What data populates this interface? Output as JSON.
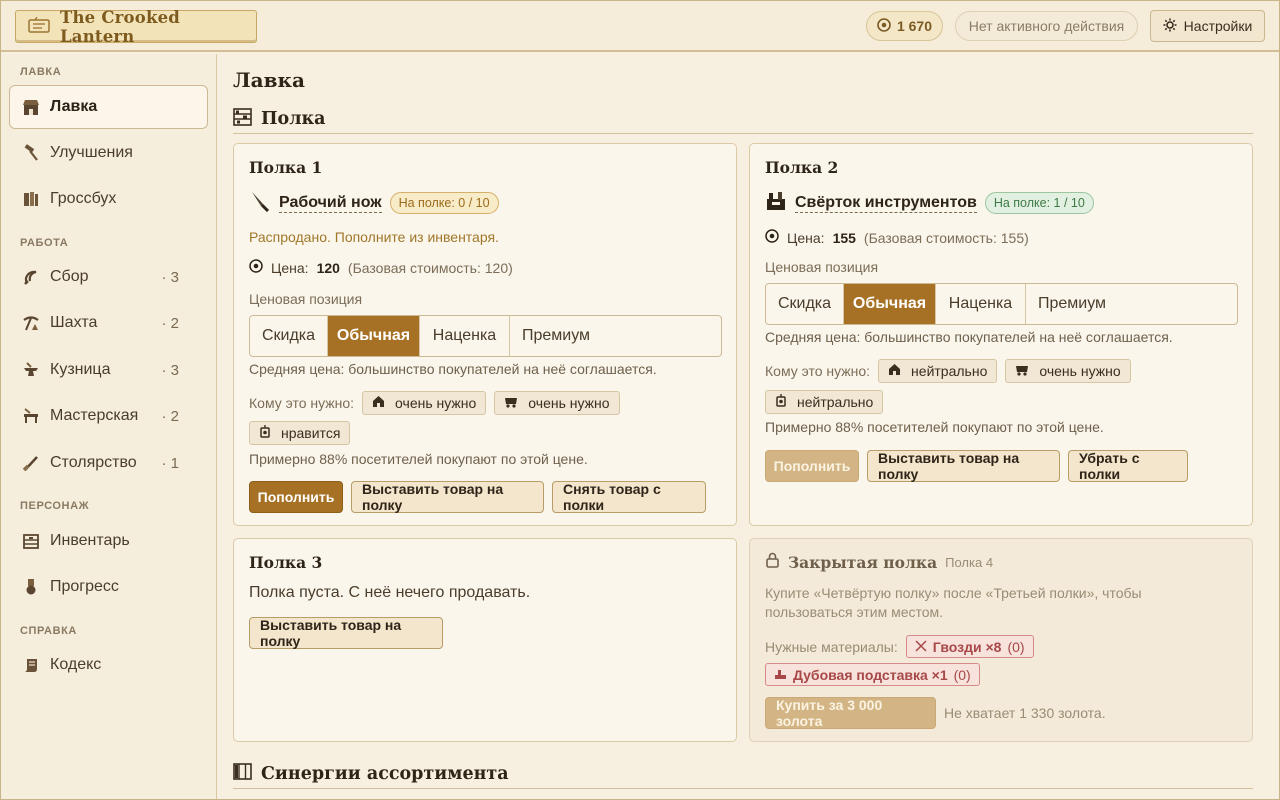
{
  "header": {
    "brand": "The Crooked Lantern",
    "gold": "1 670",
    "status": "Нет активного действия",
    "settings_label": "Настройки"
  },
  "sidebar": {
    "sections": [
      "ЛАВКА",
      "РАБОТА",
      "ПЕРСОНАЖ",
      "СПРАВКА"
    ],
    "items": [
      {
        "label": "Лавка",
        "icon": "shop-icon",
        "count": ""
      },
      {
        "label": "Улучшения",
        "icon": "hammer-icon",
        "count": ""
      },
      {
        "label": "Гроссбух",
        "icon": "ledger-icon",
        "count": ""
      },
      {
        "label": "Сбор",
        "icon": "sickle-icon",
        "count": "· 3"
      },
      {
        "label": "Шахта",
        "icon": "pickaxe-icon",
        "count": "· 2"
      },
      {
        "label": "Кузница",
        "icon": "anvil-icon",
        "count": "· 3"
      },
      {
        "label": "Мастерская",
        "icon": "workbench-icon",
        "count": "· 2"
      },
      {
        "label": "Столярство",
        "icon": "chisel-icon",
        "count": "· 1"
      },
      {
        "label": "Инвентарь",
        "icon": "inventory-icon",
        "count": ""
      },
      {
        "label": "Прогресс",
        "icon": "medal-icon",
        "count": ""
      },
      {
        "label": "Кодекс",
        "icon": "scroll-icon",
        "count": ""
      }
    ]
  },
  "main": {
    "title": "Лавка",
    "shelf_section": "Полка",
    "synergy_section": "Синергии ассортимента",
    "price_label": "Цена:",
    "price_position_label": "Ценовая позиция",
    "price_options": [
      "Скидка",
      "Обычная",
      "Наценка",
      "Премиум"
    ],
    "who_needs_label": "Кому это нужно:",
    "shelves": [
      {
        "title": "Полка 1",
        "item": "Рабочий нож",
        "badge": "На полке: 0 / 10",
        "soldout": "Распродано. Пополните из инвентаря.",
        "price": "120",
        "base": "(Базовая стоимость: 120)",
        "selected": "Обычная",
        "note": "Средняя цена: большинство покупателей на неё соглашается.",
        "needs": [
          {
            "icon": "house-icon",
            "text": "очень нужно"
          },
          {
            "icon": "wagon-icon",
            "text": "очень нужно"
          },
          {
            "icon": "lantern-icon",
            "text": "нравится"
          }
        ],
        "chance": "Примерно 88% посетителей покупают по этой цене.",
        "buttons": [
          "Пополнить",
          "Выставить товар на полку",
          "Снять товар с полки"
        ]
      },
      {
        "title": "Полка 2",
        "item": "Свёрток инструментов",
        "badge": "На полке: 1 / 10",
        "price": "155",
        "base": "(Базовая стоимость: 155)",
        "selected": "Обычная",
        "note": "Средняя цена: большинство покупателей на неё соглашается.",
        "needs": [
          {
            "icon": "house-icon",
            "text": "нейтрально"
          },
          {
            "icon": "wagon-icon",
            "text": "очень нужно"
          },
          {
            "icon": "lantern-icon",
            "text": "нейтрально"
          }
        ],
        "chance": "Примерно 88% посетителей покупают по этой цене.",
        "buttons": [
          "Пополнить",
          "Выставить товар на полку",
          "Убрать с полки"
        ]
      },
      {
        "title": "Полка 3",
        "empty_text": "Полка пуста. С неё нечего продавать.",
        "buttons": [
          "Выставить товар на полку"
        ]
      },
      {
        "title": "Закрытая полка",
        "subtitle": "Полка 4",
        "desc": "Купите «Четвёртую полку» после «Третьей полки», чтобы пользоваться этим местом.",
        "materials_label": "Нужные материалы:",
        "materials": [
          {
            "name": "Гвозди ×8",
            "have": "(0)"
          },
          {
            "name": "Дубовая подставка ×1",
            "have": "(0)"
          }
        ],
        "buy_label": "Купить за 3 000 золота",
        "missing": "Не хватает 1 330 золота."
      }
    ]
  }
}
